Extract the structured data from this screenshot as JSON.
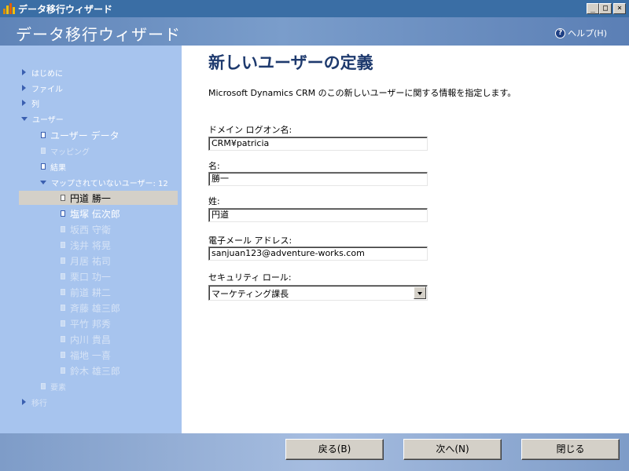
{
  "window": {
    "title": "データ移行ウィザード",
    "controls": [
      "_",
      "□",
      "×"
    ]
  },
  "header": {
    "title": "データ移行ウィザード",
    "help_label": "ヘルプ(H)",
    "help_icon": "?"
  },
  "sidebar": {
    "items": [
      {
        "label": "はじめに",
        "icon": "arrow-right"
      },
      {
        "label": "ファイル",
        "icon": "arrow-right"
      },
      {
        "label": "列",
        "icon": "arrow-right"
      },
      {
        "label": "ユーザー",
        "icon": "arrow-down"
      },
      {
        "label": "ユーザー データ",
        "icon": "doc"
      },
      {
        "label": "マッピング",
        "icon": "doc"
      },
      {
        "label": "結果",
        "icon": "doc"
      },
      {
        "label": "マップされていないユーザー: 12",
        "icon": "arrow-down"
      },
      {
        "label": "円道 勝一",
        "icon": "doc"
      },
      {
        "label": "塩塚 伝次郎",
        "icon": "doc"
      },
      {
        "label": "坂西 守衛",
        "icon": "doc"
      },
      {
        "label": "浅井 将晃",
        "icon": "doc"
      },
      {
        "label": "月居 祐司",
        "icon": "doc"
      },
      {
        "label": "栗口 功一",
        "icon": "doc"
      },
      {
        "label": "前道 耕二",
        "icon": "doc"
      },
      {
        "label": "斉藤 雄三郎",
        "icon": "doc"
      },
      {
        "label": "平竹 邦秀",
        "icon": "doc"
      },
      {
        "label": "内川 貴昌",
        "icon": "doc"
      },
      {
        "label": "福地 一喜",
        "icon": "doc"
      },
      {
        "label": "鈴木 雄三郎",
        "icon": "doc"
      },
      {
        "label": "要素",
        "icon": "doc"
      },
      {
        "label": "移行",
        "icon": "arrow-right"
      }
    ]
  },
  "main": {
    "title": "新しいユーザーの定義",
    "description": "Microsoft Dynamics CRM のこの新しいユーザーに関する情報を指定します。",
    "fields": {
      "domain_logon": {
        "label": "ドメイン ログオン名:",
        "value": "CRM¥patricia"
      },
      "first_name": {
        "label": "名:",
        "value": "勝一"
      },
      "last_name": {
        "label": "姓:",
        "value": "円道"
      },
      "email": {
        "label": "電子メール アドレス:",
        "value": "sanjuan123@adventure-works.com"
      },
      "security_role": {
        "label": "セキュリティ ロール:",
        "value": "マーケティング課長"
      }
    }
  },
  "footer": {
    "back_label": "戻る(B)",
    "next_label": "次へ(N)",
    "close_label": "閉じる"
  }
}
